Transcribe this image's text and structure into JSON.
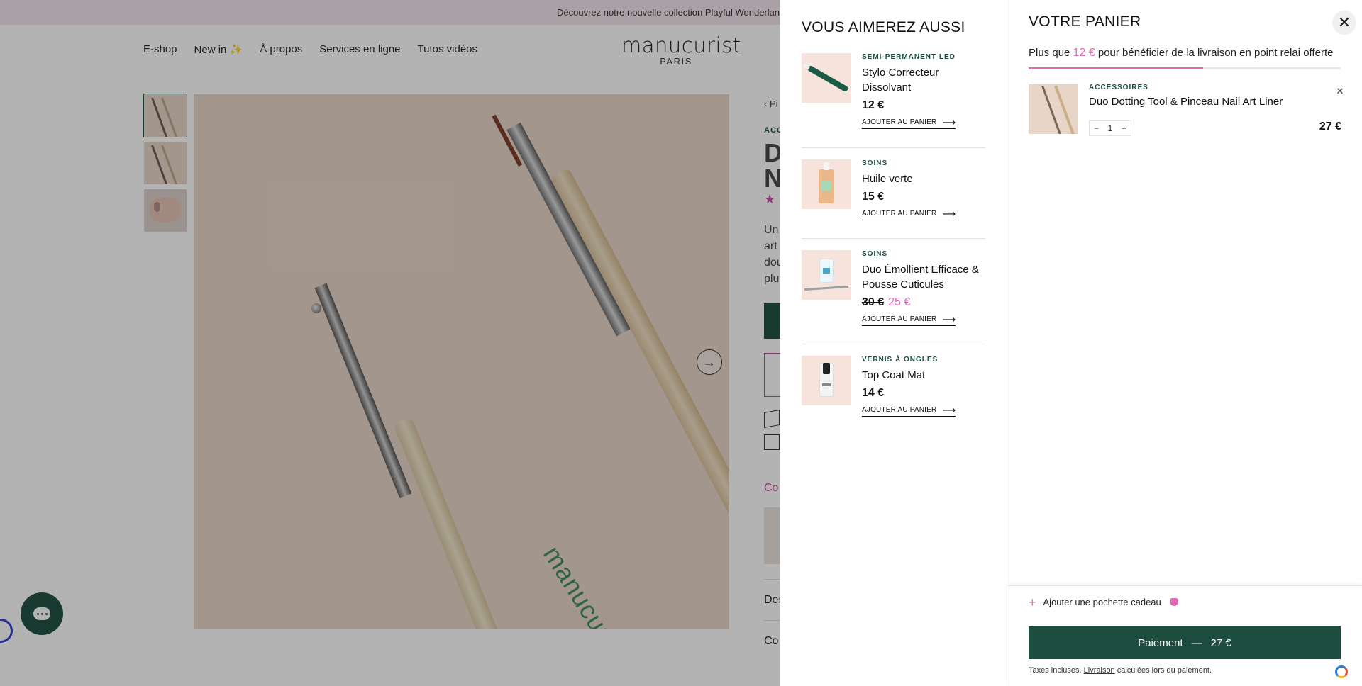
{
  "announcement": "Découvrez notre nouvelle collection Playful Wonderland",
  "nav": {
    "links": [
      "E-shop",
      "New in ✨",
      "À propos",
      "Services en ligne",
      "Tutos vidéos"
    ],
    "logo": "manucurist",
    "logo_sub": "PARIS"
  },
  "product_page": {
    "breadcrumb": "‹ Pi",
    "category": "ACC",
    "title_line1": "D",
    "title_line2": "N",
    "description": "Un\nart\ndou\nplu",
    "color_link": "Co",
    "accordion_1": "Des",
    "accordion_2": "Co",
    "image_engraving": "manucurist"
  },
  "recommendations": {
    "title": "VOUS AIMEREZ AUSSI",
    "add_label": "AJOUTER AU PANIER",
    "items": [
      {
        "category": "Semi-permanent LED",
        "name": "Stylo Correcteur Dissolvant",
        "price": "12 €",
        "icon": "corrector-pen-image"
      },
      {
        "category": "Soins",
        "name": "Huile verte",
        "price": "15 €",
        "icon": "oil-bottle-image"
      },
      {
        "category": "Soins",
        "name": "Duo Émollient Efficace & Pousse Cuticules",
        "old_price": "30 €",
        "price": "25 €",
        "icon": "cuticle-duo-image"
      },
      {
        "category": "Vernis à ongles",
        "name": "Top Coat Mat",
        "price": "14 €",
        "icon": "top-coat-image"
      }
    ]
  },
  "cart": {
    "title": "VOTRE PANIER",
    "shipping_prefix": "Plus que",
    "shipping_amount": "12 €",
    "shipping_suffix": "pour bénéficier de la livraison en point relai offerte",
    "shipping_progress": 0.56,
    "item": {
      "category": "ACCESSOIRES",
      "name": "Duo Dotting Tool & Pinceau Nail Art Liner",
      "quantity": "1",
      "price": "27 €"
    },
    "gift_label": "Ajouter une pochette cadeau",
    "checkout_label": "Paiement",
    "checkout_sep": "—",
    "checkout_total": "27 €",
    "taxes_prefix": "Taxes incluses.",
    "taxes_link": "Livraison",
    "taxes_suffix": "calculées lors du paiement."
  },
  "colors": {
    "accent_green": "#1c4d3f",
    "accent_pink": "#e06ab0"
  }
}
